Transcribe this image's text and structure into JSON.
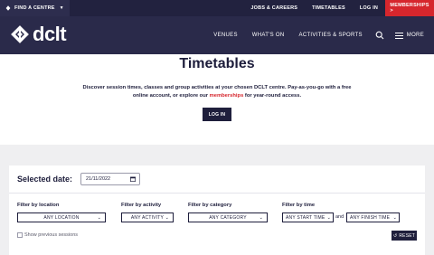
{
  "topbar": {
    "find_centre": "FIND A CENTRE",
    "links": [
      "JOBS & CAREERS",
      "TIMETABLES",
      "LOG IN"
    ],
    "memberships": "MEMBERSHIPS >"
  },
  "nav": {
    "logo_text": "dclt",
    "items": [
      "VENUES",
      "WHAT'S ON",
      "ACTIVITIES & SPORTS"
    ],
    "more": "MORE"
  },
  "hero": {
    "title": "Timetables",
    "text_before": "Discover session times, classes and group activities at your chosen DCLT centre.  Pay-as-you-go with a free online account, or explore our ",
    "link_text": "memberships",
    "text_after": " for year-round access.",
    "login_button": "LOG IN"
  },
  "filters": {
    "selected_date_label": "Selected date:",
    "selected_date_value": "21/11/2022",
    "location_label": "Filter by location",
    "location_value": "ANY LOCATION",
    "activity_label": "Filter by activity",
    "activity_value": "ANY ACTIVITY",
    "category_label": "Filter by category",
    "category_value": "ANY CATEGORY",
    "time_label": "Filter by time",
    "start_time_value": "ANY START TIME",
    "and_text": "and",
    "finish_time_value": "ANY FINISH TIME",
    "show_previous_label": "Show previous sessions",
    "reset_label": "RESET"
  },
  "colors": {
    "navy": "#2a2a4a",
    "accent_red": "#d6262d",
    "grey_bg": "#efeff1"
  }
}
